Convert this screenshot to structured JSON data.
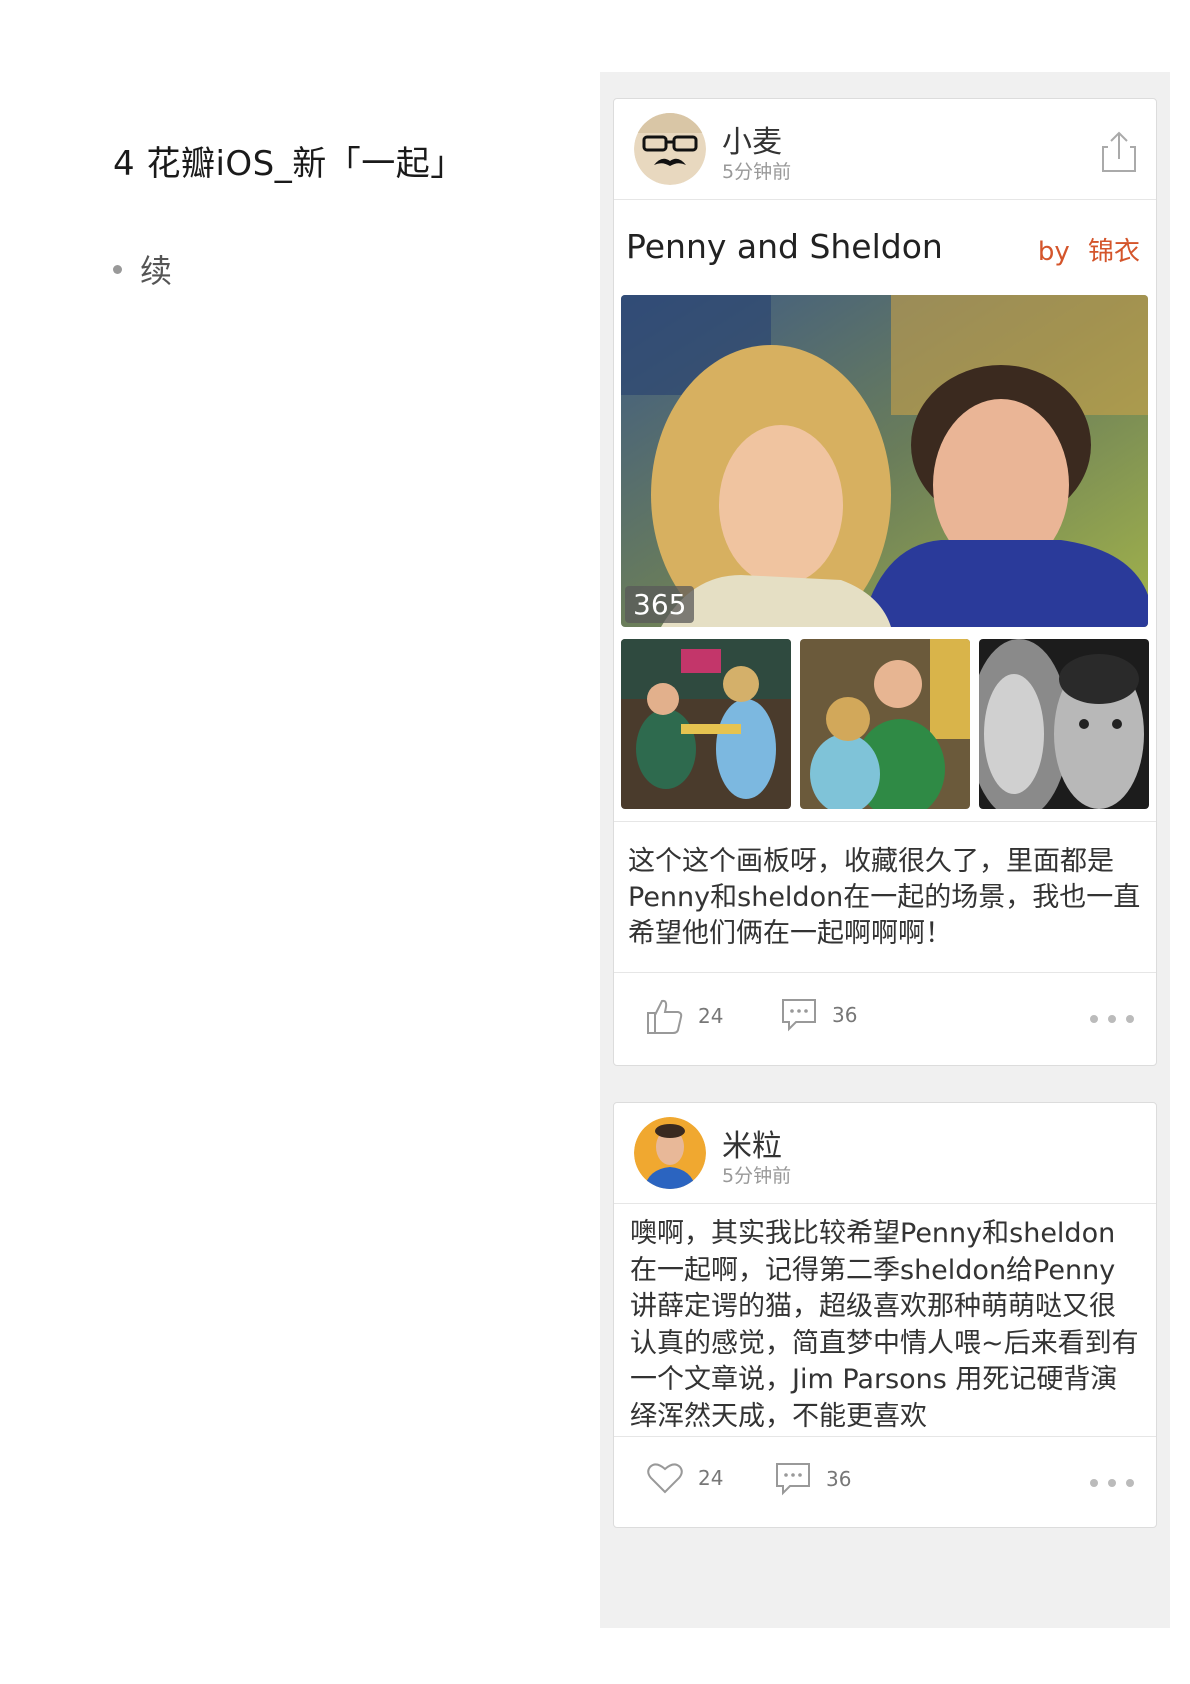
{
  "document": {
    "title": "4 花瓣iOS_新「一起」",
    "bullet": "续"
  },
  "colors": {
    "accent": "#d4552b",
    "background": "#f0f0f0",
    "card": "#ffffff"
  },
  "card1": {
    "user": {
      "name": "小麦",
      "time": "5分钟前",
      "avatar_icon": "mustache-glasses-avatar"
    },
    "share_icon": "share-icon",
    "board": {
      "title": "Penny and Sheldon",
      "by_label": "by",
      "by_name": "锦衣"
    },
    "pin_count": "365",
    "description": "这个这个画板呀，收藏很久了，里面都是Penny和sheldon在一起的场景，我也一直希望他们俩在一起啊啊啊！",
    "actions": {
      "like_count": "24",
      "comment_count": "36",
      "like_icon": "thumbs-up-icon",
      "comment_icon": "comment-icon",
      "more_icon": "more-dots-icon"
    }
  },
  "card2": {
    "user": {
      "name": "米粒",
      "time": "5分钟前",
      "avatar_icon": "portrait-avatar"
    },
    "description": "噢啊，其实我比较希望Penny和sheldon在一起啊，记得第二季sheldon给Penny讲薛定谔的猫，超级喜欢那种萌萌哒又很认真的感觉，简直梦中情人喂~后来看到有一个文章说，Jim Parsons 用死记硬背演绎浑然天成，不能更喜欢",
    "actions": {
      "like_count": "24",
      "comment_count": "36",
      "like_icon": "heart-icon",
      "comment_icon": "comment-icon",
      "more_icon": "more-dots-icon"
    }
  }
}
